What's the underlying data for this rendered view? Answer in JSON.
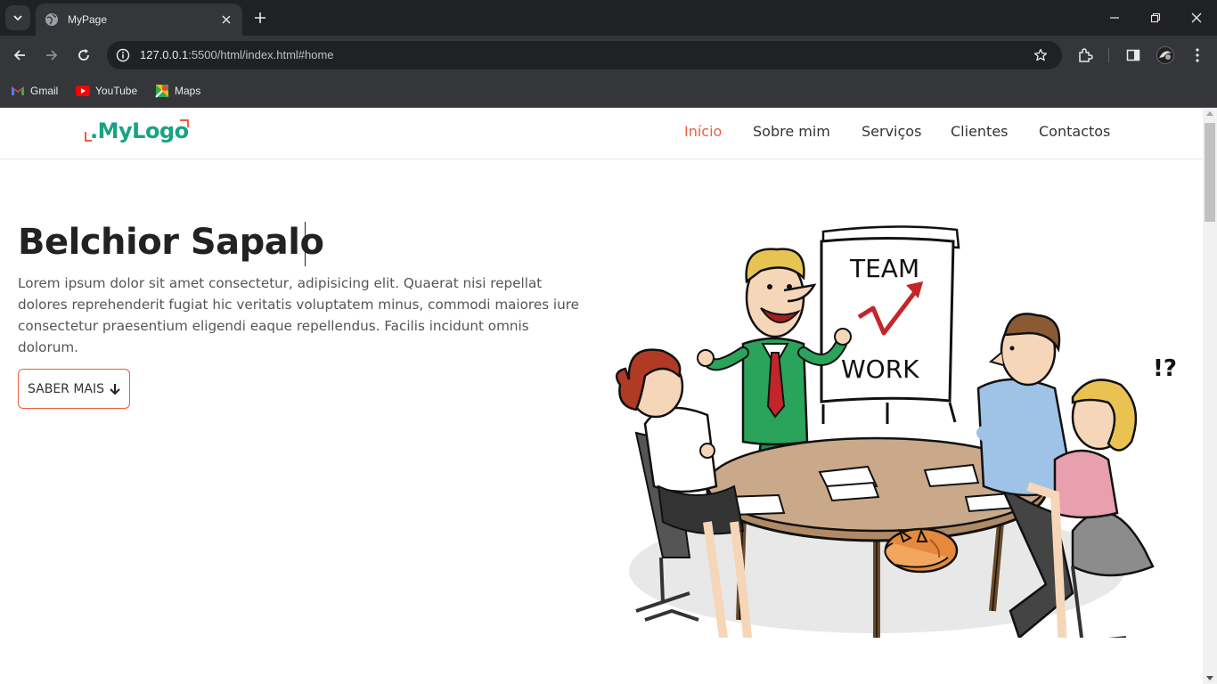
{
  "browser": {
    "tab_title": "MyPage",
    "url_host": "127.0.0.1",
    "url_rest": ":5500/html/index.html#home",
    "bookmarks": [
      {
        "label": "Gmail",
        "icon": "gmail-icon"
      },
      {
        "label": "YouTube",
        "icon": "youtube-icon"
      },
      {
        "label": "Maps",
        "icon": "maps-icon"
      }
    ]
  },
  "site": {
    "logo": ".MyLogo",
    "nav": [
      {
        "label": "Início",
        "active": true
      },
      {
        "label": "Sobre mim",
        "active": false
      },
      {
        "label": "Serviços",
        "active": false
      },
      {
        "label": "Clientes",
        "active": false
      },
      {
        "label": "Contactos",
        "active": false
      }
    ],
    "hero": {
      "title": "Belchior Sapalo",
      "text": "Lorem ipsum dolor sit amet consectetur, adipisicing elit. Quaerat nisi repellat dolores reprehenderit fugiat hic veritatis voluptatem minus, commodi maiores iure consectetur praesentium eligendi eaque repellendus. Facilis incidunt omnis dolorum.",
      "button": "SABER MAIS",
      "illustration": {
        "board_word_1": "TEAM",
        "board_word_2": "WORK",
        "exclaim": "!?"
      }
    }
  },
  "colors": {
    "accent": "#ef5d3b",
    "logo": "#18a383",
    "chrome_dark": "#202124",
    "chrome": "#35363a"
  }
}
